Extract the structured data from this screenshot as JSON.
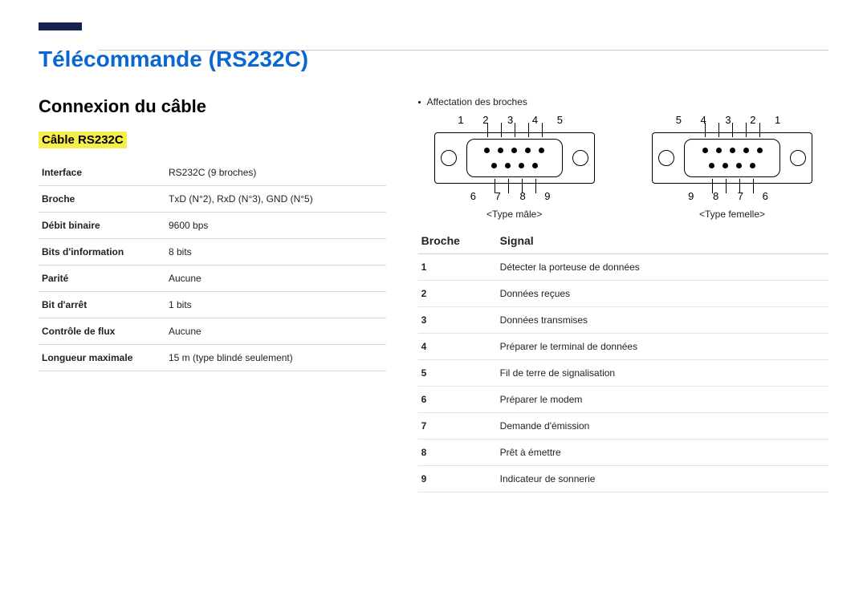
{
  "title": "Télécommande (RS232C)",
  "section": "Connexion du câble",
  "cable_heading": "Câble RS232C",
  "spec": [
    {
      "k": "Interface",
      "v": "RS232C (9 broches)"
    },
    {
      "k": "Broche",
      "v": "TxD (N°2), RxD (N°3), GND (N°5)"
    },
    {
      "k": "Débit binaire",
      "v": "9600 bps"
    },
    {
      "k": "Bits d'information",
      "v": "8 bits"
    },
    {
      "k": "Parité",
      "v": "Aucune"
    },
    {
      "k": "Bit d'arrêt",
      "v": "1 bits"
    },
    {
      "k": "Contrôle de flux",
      "v": "Aucune"
    },
    {
      "k": "Longueur maximale",
      "v": "15 m (type blindé seulement)"
    }
  ],
  "pin_assignment_label": "Affectation des broches",
  "male": {
    "top": "1 2 3 4 5",
    "bot": "6 7 8 9",
    "caption": "<Type mâle>"
  },
  "female": {
    "top": "5 4 3 2 1",
    "bot": "9 8 7 6",
    "caption": "<Type femelle>"
  },
  "pin_table": {
    "head_pin": "Broche",
    "head_sig": "Signal",
    "rows": [
      {
        "n": "1",
        "s": "Détecter la porteuse de données"
      },
      {
        "n": "2",
        "s": "Données reçues"
      },
      {
        "n": "3",
        "s": "Données transmises"
      },
      {
        "n": "4",
        "s": "Préparer le terminal de données"
      },
      {
        "n": "5",
        "s": "Fil de terre de signalisation"
      },
      {
        "n": "6",
        "s": "Préparer le modem"
      },
      {
        "n": "7",
        "s": "Demande d'émission"
      },
      {
        "n": "8",
        "s": "Prêt à émettre"
      },
      {
        "n": "9",
        "s": "Indicateur de sonnerie"
      }
    ]
  }
}
